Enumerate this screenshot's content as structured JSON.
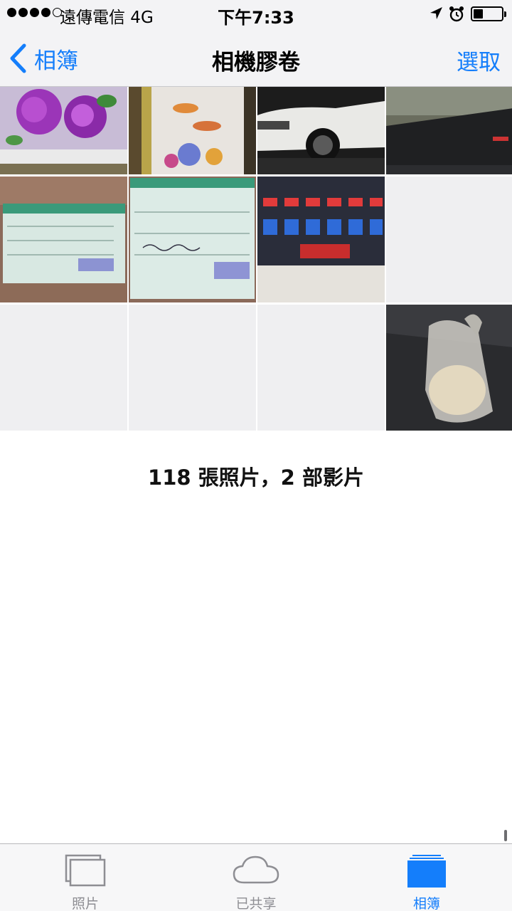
{
  "status_bar": {
    "carrier": "遠傳電信  4G",
    "time": "下午7:33",
    "signal_bars_filled": 4,
    "signal_bars_total": 5,
    "battery_level": 0.25,
    "icons": [
      "location-arrow-icon",
      "alarm-clock-icon",
      "battery-icon"
    ]
  },
  "nav": {
    "back_label": "相簿",
    "title": "相機膠卷",
    "select_label": "選取",
    "accent_color": "#147efb"
  },
  "grid": {
    "thumbnails": [
      "purple-roses-cross-stitch",
      "koi-fish-painting",
      "white-car",
      "car-dashboard-mat",
      "delivery-receipt",
      "delivery-receipt-handwritten",
      "digital-counter-display",
      "blank-gray",
      "blank-gray",
      "blank-gray",
      "blank-gray",
      "plastic-bag-package"
    ]
  },
  "footer_count": "118 張照片，2 部影片",
  "tabbar": {
    "tabs": [
      {
        "label": "照片",
        "icon": "photos-stack-icon",
        "active": false
      },
      {
        "label": "已共享",
        "icon": "cloud-icon",
        "active": false
      },
      {
        "label": "相簿",
        "icon": "albums-icon",
        "active": true
      }
    ]
  }
}
